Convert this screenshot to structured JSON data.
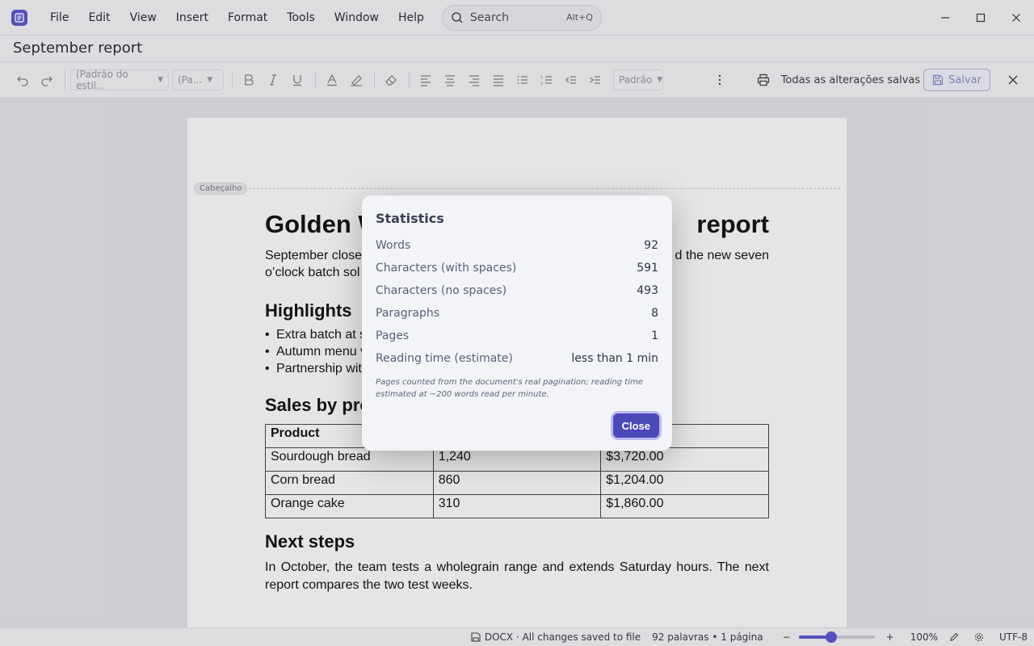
{
  "menu": {
    "items": [
      "File",
      "Edit",
      "View",
      "Insert",
      "Format",
      "Tools",
      "Window",
      "Help"
    ],
    "search_label": "Search",
    "search_shortcut": "Alt+Q"
  },
  "document": {
    "title": "September report"
  },
  "toolbar": {
    "style_select": "(Padrão do estil...",
    "paragraph_select": "(Pa...",
    "spacing_select": "Padrão",
    "save_status": "Todas as alterações salvas",
    "save_label": "Salvar"
  },
  "page": {
    "header_tag": "Cabeçalho",
    "h1": "Golden W ... report",
    "h1_left": "Golden W",
    "h1_right": "report",
    "intro_left": "September close",
    "intro_right": "d the new seven",
    "intro_line2": "o’clock batch sol",
    "highlights_heading": "Highlights",
    "highlights": [
      "Extra batch at s",
      "Autumn menu v",
      "Partnership wit"
    ],
    "sales_heading": "Sales by pro",
    "table": {
      "header": [
        "Product",
        "",
        ""
      ],
      "rows": [
        [
          "Sourdough bread",
          "1,240",
          "$3,720.00"
        ],
        [
          "Corn bread",
          "860",
          "$1,204.00"
        ],
        [
          "Orange cake",
          "310",
          "$1,860.00"
        ]
      ]
    },
    "next_heading": "Next steps",
    "next_text": "In October, the team tests a wholegrain range and extends Saturday hours. The next report compares the two test weeks."
  },
  "dialog": {
    "title": "Statistics",
    "stats": [
      {
        "label": "Words",
        "value": "92"
      },
      {
        "label": "Characters (with spaces)",
        "value": "591"
      },
      {
        "label": "Characters (no spaces)",
        "value": "493"
      },
      {
        "label": "Paragraphs",
        "value": "8"
      },
      {
        "label": "Pages",
        "value": "1"
      },
      {
        "label": "Reading time (estimate)",
        "value": "less than 1 min"
      }
    ],
    "note": "Pages counted from the document's real pagination; reading time estimated at ~200 words read per minute.",
    "close_label": "Close"
  },
  "status": {
    "format_info": "DOCX · All changes saved to file",
    "counts": "92 palavras • 1 página",
    "zoom_minus": "−",
    "zoom_plus": "+",
    "zoom_fraction": 0.43,
    "zoom_level": "100%",
    "encoding": "UTF-8"
  },
  "colors": {
    "accent": "#5b57d1",
    "close_button": "#4b48b8"
  }
}
